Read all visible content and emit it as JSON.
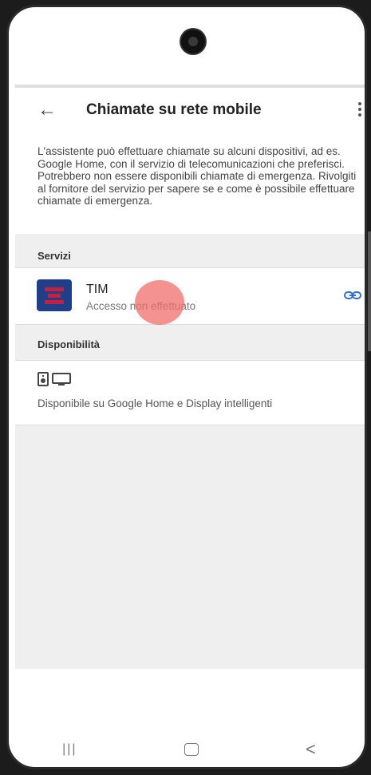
{
  "appbar": {
    "back_icon": "arrow-left-icon",
    "title": "Chiamate su rete mobile",
    "more_icon": "more-vert-icon"
  },
  "description": "L'assistente può effettuare chiamate su alcuni dispositivi, ad es. Google Home, con il servizio di telecomunicazioni che preferisci. Potrebbero non essere disponibili chiamate di emergenza. Rivolgiti al fornitore del servizio per sapere se e come è possibile effettuare chiamate di emergenza.",
  "services": {
    "label": "Servizi",
    "items": [
      {
        "name": "TIM",
        "status": "Accesso non effettuato",
        "logo_color": "#1f3f8a",
        "accent_color": "#c8203c",
        "action_icon": "link-icon"
      }
    ]
  },
  "availability": {
    "label": "Disponibilità",
    "icons": [
      "speaker-icon",
      "display-icon"
    ],
    "text": "Disponibile su Google Home e Display intelligenti"
  },
  "navbar": {
    "icons": [
      "recents-icon",
      "home-icon",
      "back-icon"
    ]
  },
  "colors": {
    "link": "#2f6fd6",
    "tap_indicator": "#f06e6e"
  }
}
